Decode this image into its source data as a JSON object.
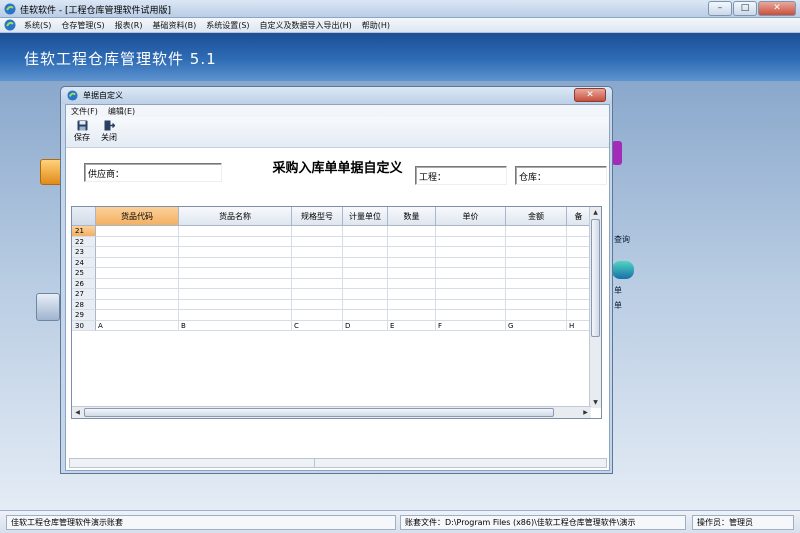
{
  "window": {
    "title": "佳软软件 - [工程仓库管理软件试用版]",
    "controls": {
      "minimize": "–",
      "maximize": "□",
      "close": "✕"
    }
  },
  "menubar": {
    "items": [
      "系统(S)",
      "仓存管理(S)",
      "报表(R)",
      "基础资料(B)",
      "系统设置(S)",
      "自定义及数据导入导出(H)",
      "帮助(H)"
    ]
  },
  "banner": {
    "app_title": "佳软工程仓库管理软件 5.1"
  },
  "desktop": {
    "labels": [
      "查询",
      "单",
      "单"
    ]
  },
  "status_bar": {
    "account_name": "佳软工程仓库管理软件演示账套",
    "account_file": "账套文件：D:\\Program Files (x86)\\佳软工程仓库管理软件\\演示",
    "operator": "操作员：管理员"
  },
  "dialog": {
    "title": "单据自定义",
    "close": "✕",
    "menu": [
      "文件(F)",
      "编辑(E)"
    ],
    "toolbar": {
      "save": "保存",
      "close": "关闭"
    },
    "doc_title": "采购入库单单据自定义",
    "fields": {
      "supplier": "供应商：",
      "project": "工程：",
      "warehouse": "仓库："
    },
    "grid": {
      "columns": [
        "货品代码",
        "货品名称",
        "规格型号",
        "计量单位",
        "数量",
        "单价",
        "金额",
        "备"
      ],
      "row_numbers": [
        "21",
        "22",
        "23",
        "24",
        "25",
        "26",
        "27",
        "28",
        "29",
        "30"
      ],
      "last_row_letters": [
        "A",
        "B",
        "C",
        "D",
        "E",
        "F",
        "G",
        "H"
      ],
      "current_row": "21",
      "selected_column": "货品代码"
    }
  },
  "colors": {
    "banner": "#2e6cb5",
    "selection": "#f3b061",
    "close_button": "#c7503c"
  },
  "icons": [
    "app-logo-icon",
    "save-icon",
    "close-doc-icon",
    "scroll-up-icon",
    "scroll-down-icon",
    "scroll-left-icon",
    "scroll-right-icon"
  ]
}
